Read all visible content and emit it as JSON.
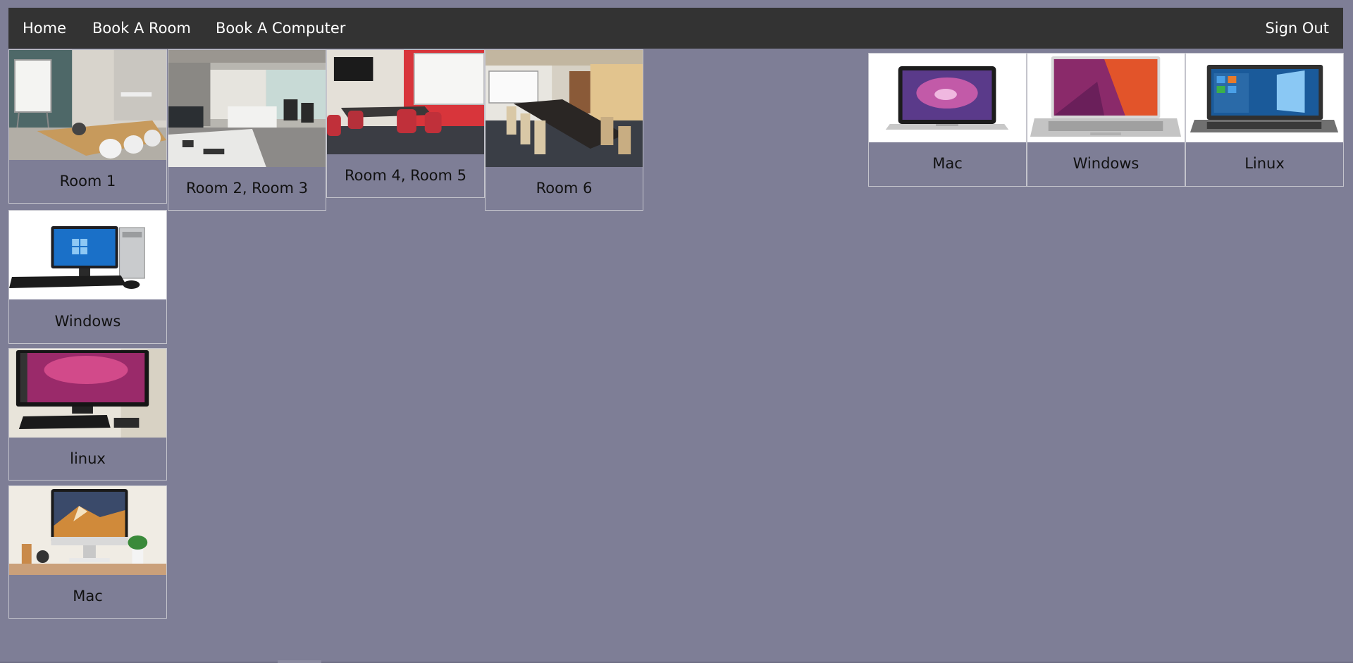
{
  "nav": {
    "home": "Home",
    "book_room": "Book A Room",
    "book_computer": "Book A Computer",
    "sign_out": "Sign Out"
  },
  "rooms": [
    {
      "label": "Room 1",
      "image": "meeting-room-photo"
    },
    {
      "label": "Room 2, Room 3",
      "image": "open-office-photo"
    },
    {
      "label": "Room 4, Room 5",
      "image": "red-wall-meeting-room-photo"
    },
    {
      "label": "Room 6",
      "image": "boardroom-photo"
    }
  ],
  "desktops": [
    {
      "label": "Windows",
      "image": "windows-desktop-photo"
    },
    {
      "label": "linux",
      "image": "linux-desktop-photo"
    },
    {
      "label": "Mac",
      "image": "imac-photo"
    }
  ],
  "laptops": [
    {
      "label": "Mac",
      "image": "macbook-photo"
    },
    {
      "label": "Windows",
      "image": "ubuntu-laptop-photo"
    },
    {
      "label": "Linux",
      "image": "windows-laptop-photo"
    }
  ],
  "colors": {
    "page_background": "#7e7e96",
    "navbar_background": "#333333",
    "nav_text": "#ffffff",
    "card_border": "#c4c4cc"
  }
}
